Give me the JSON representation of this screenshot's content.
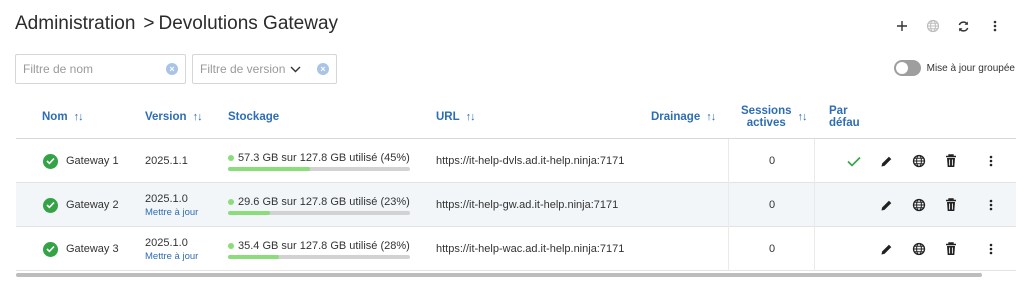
{
  "breadcrumb": {
    "root": "Administration",
    "separator": ">",
    "current": "Devolutions Gateway"
  },
  "toolbar": {
    "add_icon": "plus-icon",
    "globe_icon": "globe-icon",
    "refresh_icon": "refresh-icon",
    "more_icon": "more-vertical-icon"
  },
  "filters": {
    "name_placeholder": "Filtre de nom",
    "version_placeholder": "Filtre de version",
    "clear_symbol": "×"
  },
  "group_update": {
    "label": "Mise à jour groupée",
    "enabled": false
  },
  "table": {
    "headers": {
      "name": "Nom",
      "version": "Version",
      "storage": "Stockage",
      "url": "URL",
      "drain": "Drainage",
      "sessions_line1": "Sessions",
      "sessions_line2": "actives",
      "default_line1": "Par",
      "default_line2": "défau",
      "sort_name": "↑↓",
      "sort_other": "↑↓"
    },
    "rows": [
      {
        "name": "Gateway 1",
        "version": "2025.1.1",
        "update_link": "",
        "storage": "57.3 GB sur 127.8 GB utilisé (45%)",
        "storage_pct": 45,
        "url": "https://it-help-dvls.ad.it-help.ninja:7171",
        "sessions": "0",
        "is_default": true
      },
      {
        "name": "Gateway 2",
        "version": "2025.1.0",
        "update_link": "Mettre à jour",
        "storage": "29.6 GB sur 127.8 GB utilisé (23%)",
        "storage_pct": 23,
        "url": "https://it-help-gw.ad.it-help.ninja:7171",
        "sessions": "0",
        "is_default": false
      },
      {
        "name": "Gateway 3",
        "version": "2025.1.0",
        "update_link": "Mettre à jour",
        "storage": "35.4 GB sur 127.8 GB utilisé (28%)",
        "storage_pct": 28,
        "url": "https://it-help-wac.ad.it-help.ninja:7171",
        "sessions": "0",
        "is_default": false
      }
    ]
  },
  "colors": {
    "accent": "#2e6db4",
    "status_ok": "#33a346",
    "storage_fill": "#8bdc7a"
  }
}
